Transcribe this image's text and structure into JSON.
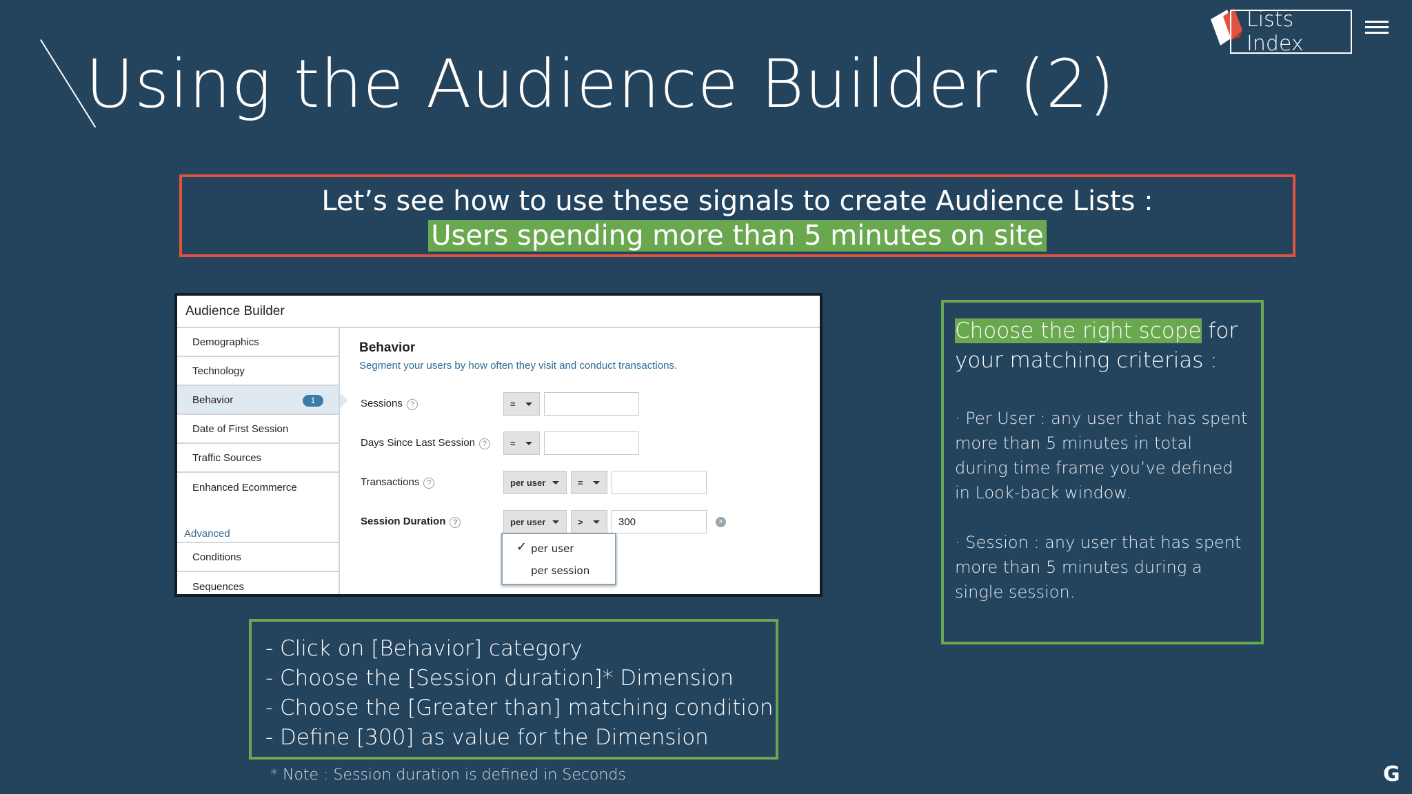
{
  "slide": {
    "title": "Using the Audience Builder (2)",
    "lists_index_label": "Lists Index",
    "callout_line1": "Let’s see how to use these signals to create Audience Lists :",
    "callout_line2": "Users spending more than 5 minutes on site",
    "logo_letter": "G"
  },
  "colors": {
    "background": "#24445e",
    "callout_border": "#e1533f",
    "green": "#6aa84f"
  },
  "audience_builder": {
    "header": "Audience Builder",
    "sidebar": [
      {
        "label": "Demographics"
      },
      {
        "label": "Technology"
      },
      {
        "label": "Behavior",
        "badge": "1",
        "active": true
      },
      {
        "label": "Date of First Session"
      },
      {
        "label": "Traffic Sources"
      },
      {
        "label": "Enhanced Ecommerce"
      }
    ],
    "advanced_label": "Advanced",
    "advanced_items": [
      {
        "label": "Conditions"
      },
      {
        "label": "Sequences"
      }
    ],
    "main_title": "Behavior",
    "main_subtitle": "Segment your users by how often they visit and conduct transactions.",
    "rows": {
      "sessions": {
        "label": "Sessions",
        "operator": "="
      },
      "days_since": {
        "label": "Days Since Last Session",
        "operator": "="
      },
      "transactions": {
        "label": "Transactions",
        "scope": "per user",
        "operator": "="
      },
      "session_duration": {
        "label": "Session Duration",
        "scope": "per user",
        "operator": ">",
        "value": "300"
      }
    },
    "scope_menu": {
      "options": [
        "per user",
        "per session"
      ],
      "checkmark": "✓"
    },
    "help_glyph": "?",
    "clear_glyph": "×"
  },
  "scope_note": {
    "heading_highlight": "Choose the right scope",
    "heading_rest": " for your matching criterias :",
    "per_user": "· Per User : any user that has spent more than 5 minutes in total during time frame you’ve defined in Look-back window.",
    "session": "· Session : any user that has spent more than 5 minutes  during a single session."
  },
  "steps": [
    "- Click on [Behavior] category",
    "- Choose the  [Session duration]* Dimension",
    "- Choose the [Greater than] matching condition",
    "- Define  [300] as value for the Dimension"
  ],
  "footnote": "* Note : Session duration is defined in Seconds"
}
